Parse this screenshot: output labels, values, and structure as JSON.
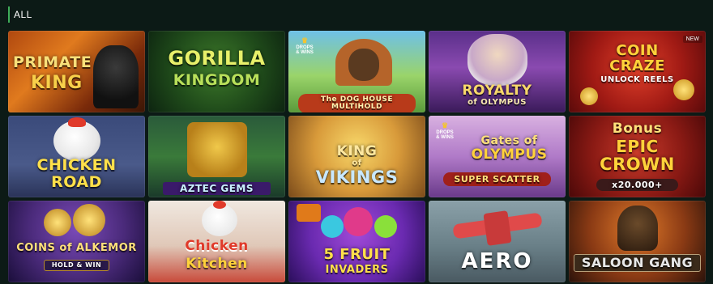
{
  "header": {
    "label": "ALL"
  },
  "tiles": [
    {
      "title_line1": "PRIMATE",
      "title_line2": "KING"
    },
    {
      "title_line1": "GORILLA",
      "title_line2": "KINGDOM"
    },
    {
      "badge_line1": "DROPS",
      "badge_line2": "& WINS",
      "title": "The DOG HOUSE MULTIHOLD"
    },
    {
      "title_line1": "ROYALTY",
      "title_line2": "of OLYMPUS"
    },
    {
      "new_badge": "NEW",
      "title_line1": "COIN",
      "title_line2": "CRAZE",
      "title_line3": "UNLOCK REELS"
    },
    {
      "title_line1": "CHICKEN",
      "title_line2": "ROAD"
    },
    {
      "title": "AZTEC GEMS"
    },
    {
      "title_line1": "KING",
      "title_line2": "of",
      "title_line3": "VIKINGS"
    },
    {
      "badge_line1": "DROPS",
      "badge_line2": "& WINS",
      "title_line1": "Gates of",
      "title_line2": "OLYMPUS",
      "title_line3": "SUPER SCATTER"
    },
    {
      "title_line1": "Bonus",
      "title_line2": "EPIC",
      "title_line3": "CROWN",
      "title_line4": "x20.000+"
    },
    {
      "title_line1": "COINS of ALKEMOR",
      "title_line2": "HOLD & WIN"
    },
    {
      "title_line1": "Chicken",
      "title_line2": "Kitchen"
    },
    {
      "title_line1": "5 FRUIT",
      "title_line2": "INVADERS"
    },
    {
      "title": "AERO"
    },
    {
      "title": "SALOON GANG"
    }
  ],
  "colors": {
    "background": "#0c1a16",
    "accent": "#3fae5a"
  }
}
